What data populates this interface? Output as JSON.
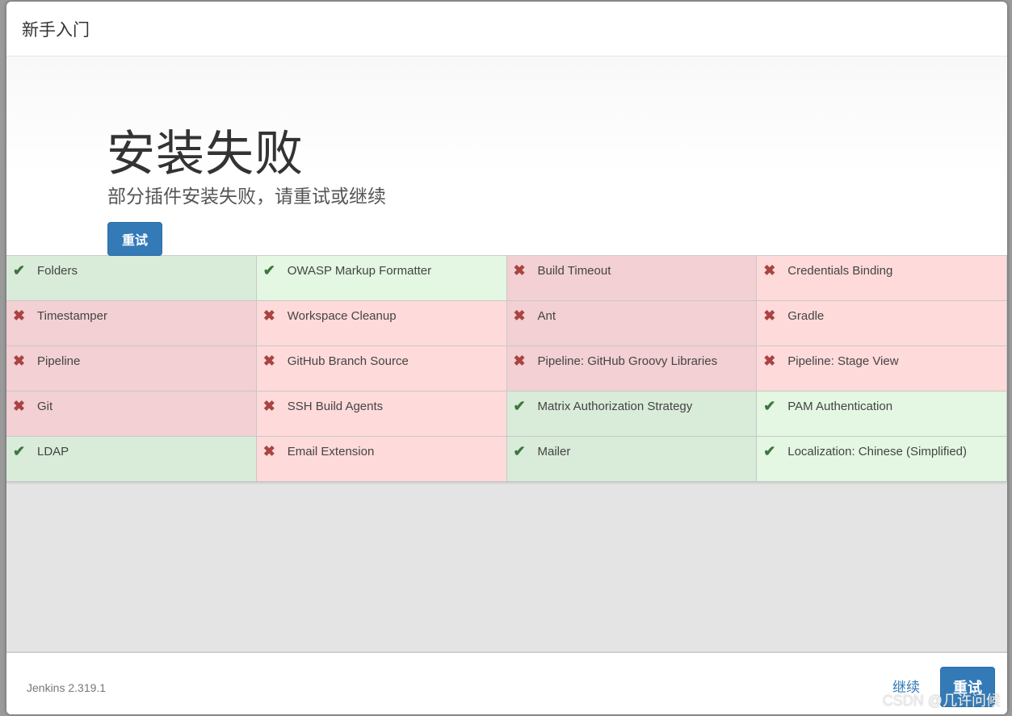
{
  "header": {
    "title": "新手入门"
  },
  "jumbotron": {
    "title": "安装失败",
    "subtitle": "部分插件安装失败，请重试或继续",
    "retry_label": "重试"
  },
  "plugins": [
    {
      "name": "Folders",
      "status": "success",
      "icon": "check-icon"
    },
    {
      "name": "OWASP Markup Formatter",
      "status": "success",
      "icon": "check-icon"
    },
    {
      "name": "Build Timeout",
      "status": "failed",
      "icon": "cross-icon"
    },
    {
      "name": "Credentials Binding",
      "status": "failed",
      "icon": "cross-icon"
    },
    {
      "name": "Timestamper",
      "status": "failed",
      "icon": "cross-icon"
    },
    {
      "name": "Workspace Cleanup",
      "status": "failed",
      "icon": "cross-icon"
    },
    {
      "name": "Ant",
      "status": "failed",
      "icon": "cross-icon"
    },
    {
      "name": "Gradle",
      "status": "failed",
      "icon": "cross-icon"
    },
    {
      "name": "Pipeline",
      "status": "failed",
      "icon": "cross-icon"
    },
    {
      "name": "GitHub Branch Source",
      "status": "failed",
      "icon": "cross-icon"
    },
    {
      "name": "Pipeline: GitHub Groovy Libraries",
      "status": "failed",
      "icon": "cross-icon"
    },
    {
      "name": "Pipeline: Stage View",
      "status": "failed",
      "icon": "cross-icon"
    },
    {
      "name": "Git",
      "status": "failed",
      "icon": "cross-icon"
    },
    {
      "name": "SSH Build Agents",
      "status": "failed",
      "icon": "cross-icon"
    },
    {
      "name": "Matrix Authorization Strategy",
      "status": "success",
      "icon": "check-icon"
    },
    {
      "name": "PAM Authentication",
      "status": "success",
      "icon": "check-icon"
    },
    {
      "name": "LDAP",
      "status": "success",
      "icon": "check-icon"
    },
    {
      "name": "Email Extension",
      "status": "failed",
      "icon": "cross-icon"
    },
    {
      "name": "Mailer",
      "status": "success",
      "icon": "check-icon"
    },
    {
      "name": "Localization: Chinese (Simplified)",
      "status": "success",
      "icon": "check-icon"
    }
  ],
  "icons": {
    "check-icon": "✔",
    "cross-icon": "✖"
  },
  "colors": {
    "primary": "#337ab7",
    "success_icon": "#3c763d",
    "failed_icon": "#a94442"
  },
  "footer": {
    "version": "Jenkins 2.319.1",
    "continue_label": "继续",
    "retry_label": "重试"
  },
  "watermark": "CSDN @几许问候"
}
